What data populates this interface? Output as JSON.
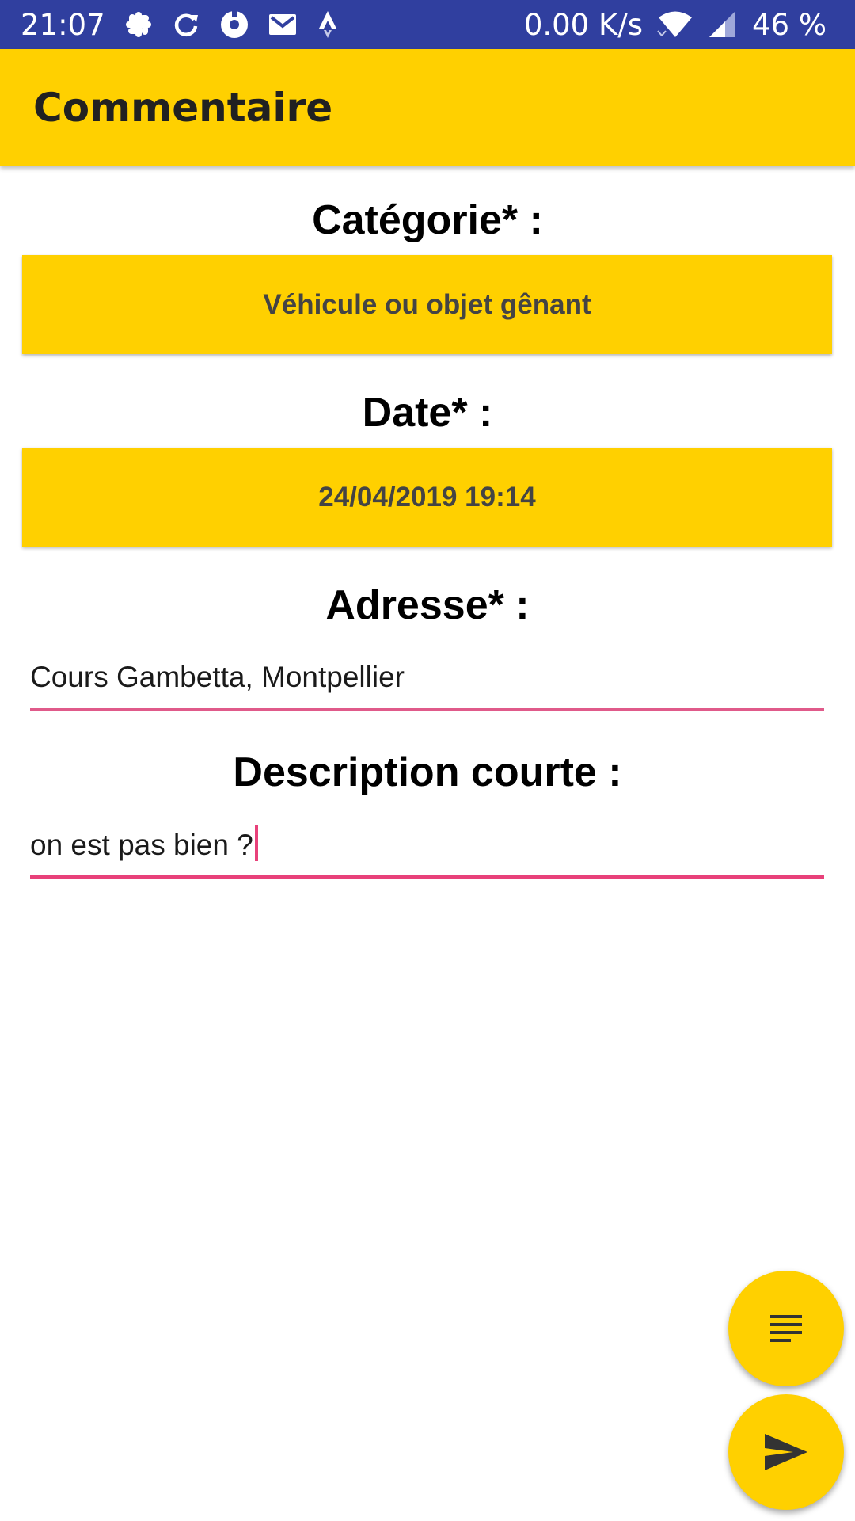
{
  "status_bar": {
    "time": "21:07",
    "notification_icons": [
      "slack-icon",
      "sync-icon",
      "donut-app-icon",
      "gmail-icon",
      "strava-icon"
    ],
    "network_speed": "0.00 K/s",
    "battery": "46 %"
  },
  "app_bar": {
    "title": "Commentaire"
  },
  "form": {
    "category_label": "Catégorie* :",
    "category_value": "Véhicule ou objet gênant",
    "date_label": "Date* :",
    "date_value": "24/04/2019 19:14",
    "address_label": "Adresse* :",
    "address_value": "Cours Gambetta, Montpellier",
    "description_label": "Description courte :",
    "description_value": "on est pas bien ?"
  },
  "fabs": {
    "notes_icon": "notes-icon",
    "send_icon": "send-icon"
  },
  "colors": {
    "status_bar": "#303f9f",
    "accent_yellow": "#ffd000",
    "field_underline": "#e8417a"
  }
}
